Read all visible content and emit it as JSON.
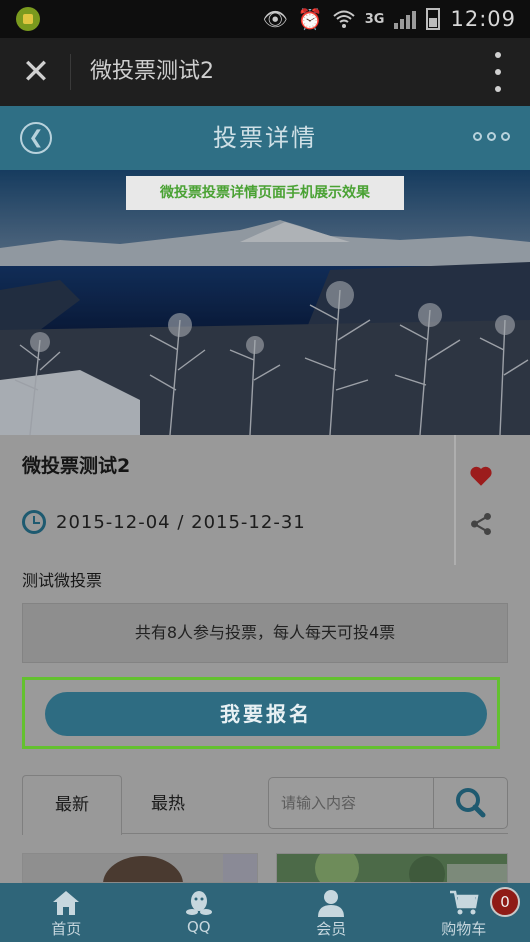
{
  "status_bar": {
    "network": "3G",
    "time": "12:09"
  },
  "wechat_bar": {
    "title": "微投票测试2"
  },
  "page_header": {
    "title": "投票详情"
  },
  "banner": {
    "caption": "微投票投票详情页面手机展示效果"
  },
  "vote": {
    "title": "微投票测试2",
    "date_range": "2015-12-04 / 2015-12-31",
    "description": "测试微投票",
    "stats": "共有8人参与投票，每人每天可投4票"
  },
  "signup": {
    "label": "我要报名"
  },
  "tabs": {
    "latest": "最新",
    "hot": "最热"
  },
  "search": {
    "placeholder": "请输入内容"
  },
  "bottom_nav": {
    "items": [
      {
        "label": "首页",
        "icon": "home-icon"
      },
      {
        "label": "QQ",
        "icon": "qq-icon"
      },
      {
        "label": "会员",
        "icon": "user-icon"
      },
      {
        "label": "购物车",
        "icon": "cart-icon"
      }
    ],
    "cart_count": "0"
  },
  "colors": {
    "header": "#2f6f85",
    "button": "#2e6c82",
    "highlight_border": "#63c12f",
    "caption_text": "#4aa234",
    "heart": "#9c1c1c"
  }
}
